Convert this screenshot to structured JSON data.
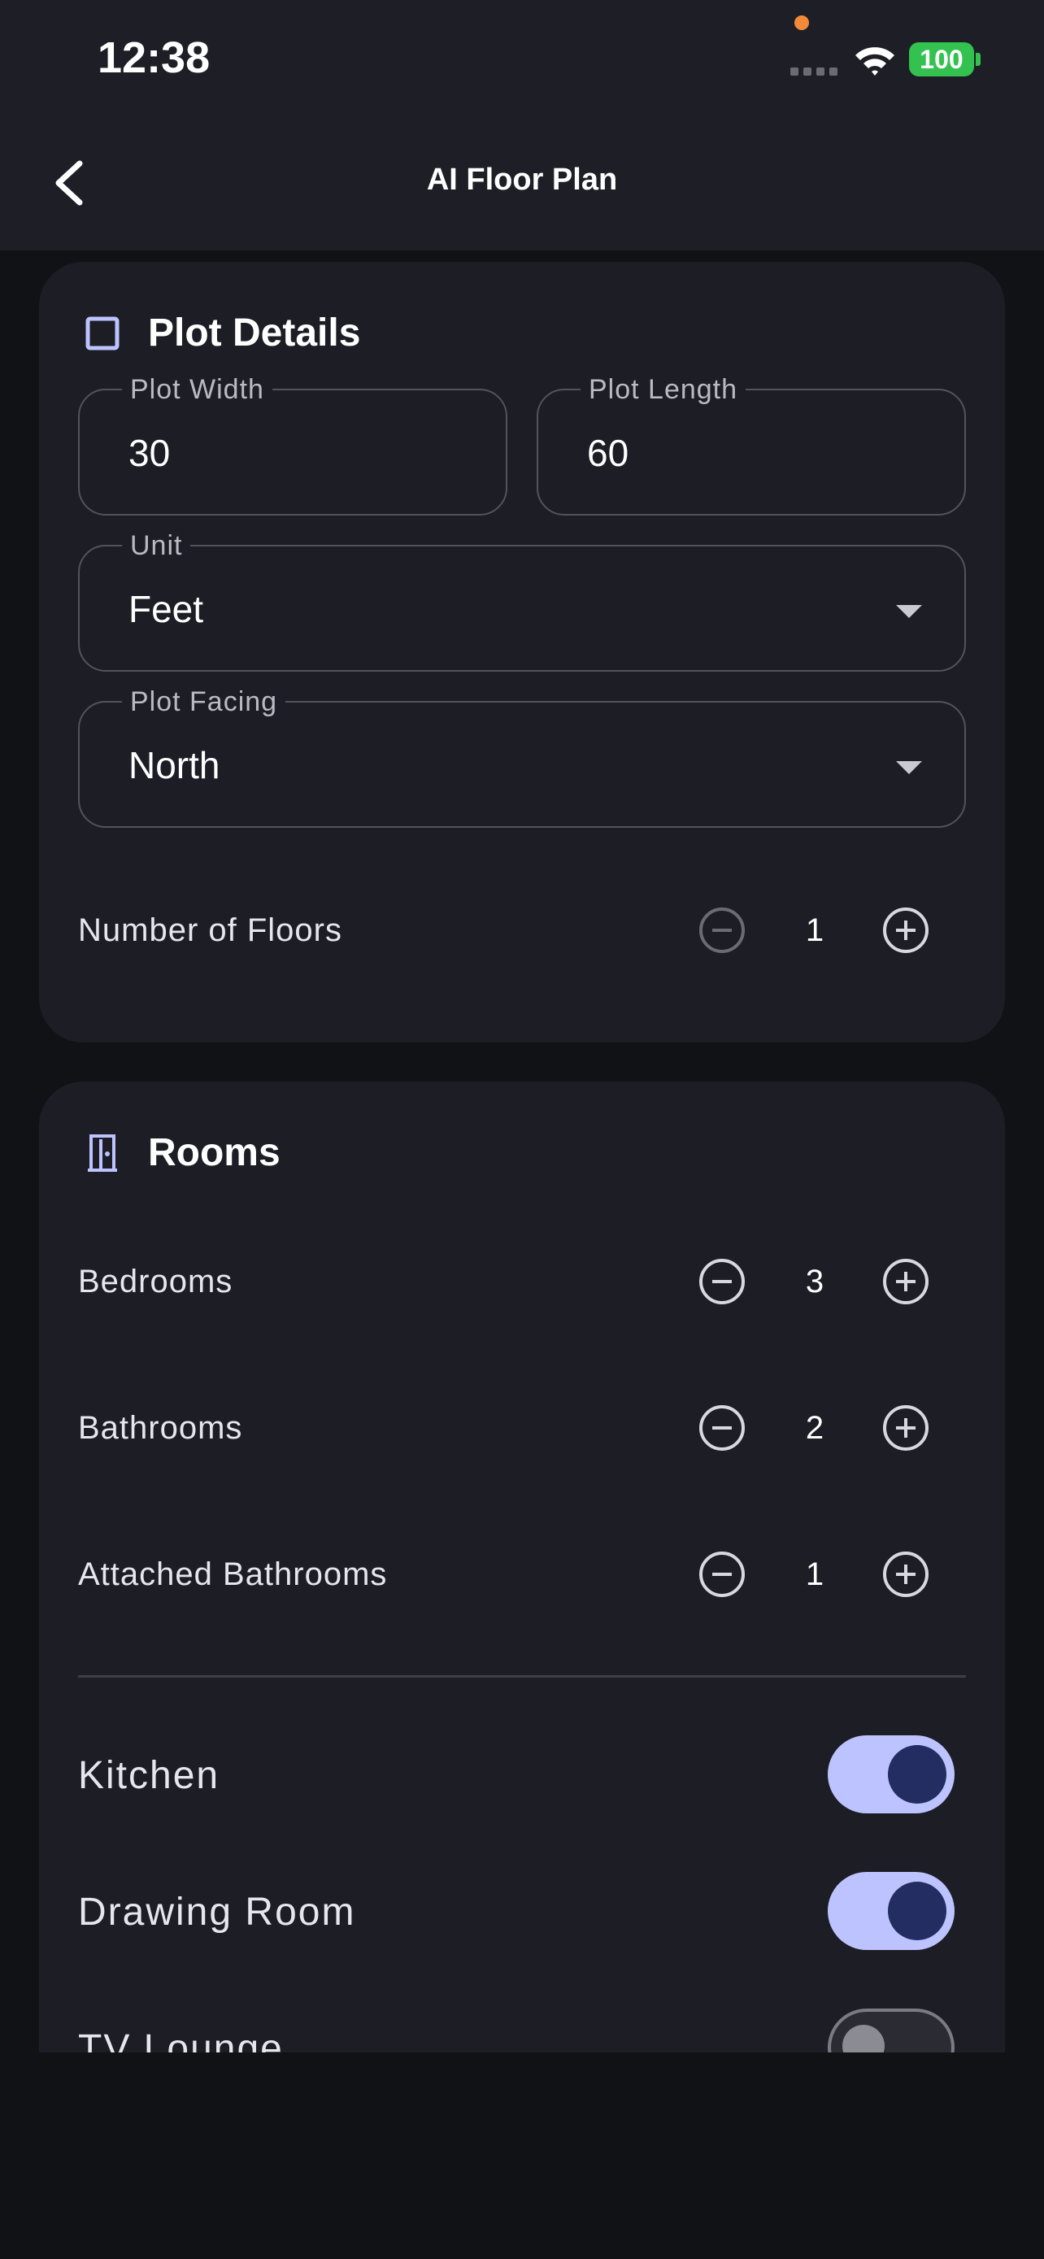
{
  "status_bar": {
    "time": "12:38",
    "battery": "100"
  },
  "header": {
    "title": "AI Floor Plan",
    "back_icon": "chevron-left-icon"
  },
  "plot_details": {
    "heading": "Plot Details",
    "icon": "square-outline-icon",
    "plot_width": {
      "label": "Plot Width",
      "value": "30"
    },
    "plot_length": {
      "label": "Plot Length",
      "value": "60"
    },
    "unit": {
      "label": "Unit",
      "value": "Feet"
    },
    "plot_facing": {
      "label": "Plot Facing",
      "value": "North"
    },
    "floors": {
      "label": "Number of Floors",
      "value": "1"
    }
  },
  "rooms": {
    "heading": "Rooms",
    "icon": "door-icon",
    "bedrooms": {
      "label": "Bedrooms",
      "value": "3"
    },
    "bathrooms": {
      "label": "Bathrooms",
      "value": "2"
    },
    "attached_bathrooms": {
      "label": "Attached Bathrooms",
      "value": "1"
    },
    "kitchen": {
      "label": "Kitchen",
      "on": true
    },
    "drawing_room": {
      "label": "Drawing Room",
      "on": true
    },
    "tv_lounge": {
      "label": "TV Lounge",
      "on": false
    }
  },
  "colors": {
    "accent": "#bcc3ff",
    "background": "#111216",
    "card": "#1c1d25",
    "battery": "#33c24f"
  }
}
